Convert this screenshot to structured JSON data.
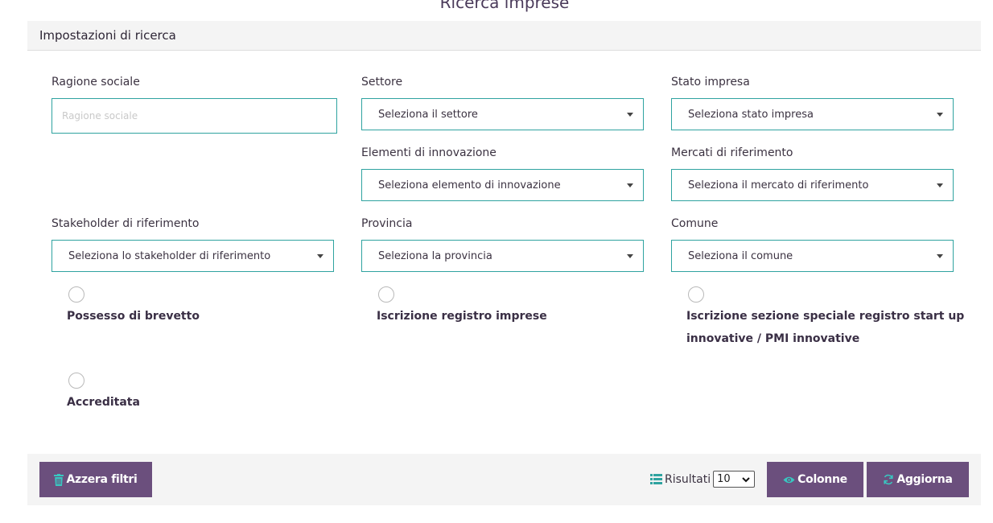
{
  "page_title": "Ricerca imprese",
  "panel": {
    "title": "Impostazioni di ricerca"
  },
  "fields": {
    "ragione_sociale": {
      "label": "Ragione sociale",
      "placeholder": "Ragione sociale",
      "value": ""
    },
    "settore": {
      "label": "Settore",
      "selected": "Seleziona il settore"
    },
    "stato_impresa": {
      "label": "Stato impresa",
      "selected": "Seleziona stato impresa"
    },
    "elementi_innovazione": {
      "label": "Elementi di innovazione",
      "selected": "Seleziona elemento di innovazione"
    },
    "mercati_riferimento": {
      "label": "Mercati di riferimento",
      "selected": "Seleziona il mercato di riferimento"
    },
    "stakeholder": {
      "label": "Stakeholder di riferimento",
      "selected": "Seleziona lo stakeholder di riferimento"
    },
    "provincia": {
      "label": "Provincia",
      "selected": "Seleziona la provincia"
    },
    "comune": {
      "label": "Comune",
      "selected": "Seleziona il comune"
    }
  },
  "options": {
    "brevetto": {
      "label": "Possesso di brevetto",
      "checked": false
    },
    "registro_imprese": {
      "label": "Iscrizione registro imprese",
      "checked": false
    },
    "startup_line1": "Iscrizione sezione speciale registro start up",
    "startup_line2": "innovative / PMI innovative",
    "startup_checked": false,
    "accreditata": {
      "label": "Accreditata",
      "checked": false
    }
  },
  "footer": {
    "reset_label": "Azzera filtri",
    "results_label": "Risultati",
    "per_page": "10",
    "columns_label": "Colonne",
    "refresh_label": "Aggiorna"
  },
  "colors": {
    "accent_teal": "#2fa3a0",
    "button_purple": "#6b4f7d",
    "icon_teal": "#39c6c0",
    "panel_gray": "#f4f4f4"
  },
  "icons": {
    "reset": "trash-icon",
    "results": "list-icon",
    "columns": "eye-icon",
    "refresh": "refresh-icon",
    "select_caret": "caret-down-icon"
  }
}
